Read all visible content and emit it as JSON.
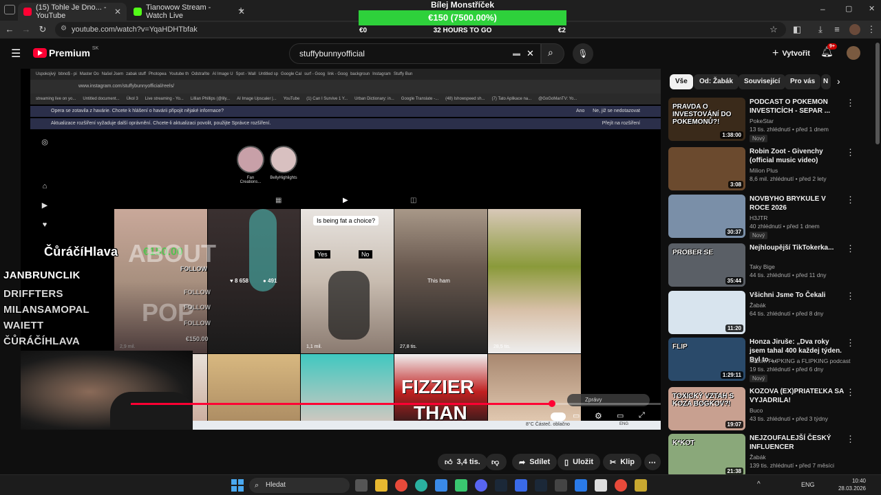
{
  "browser": {
    "tabs": [
      {
        "label": "(15) Tohle Je Dno... - YouTube",
        "active": true
      },
      {
        "label": "Tianowow Stream - Watch Live",
        "active": false
      }
    ],
    "url": "youtube.com/watch?v=YqaHDHTbfak"
  },
  "donation": {
    "name": "Bílej Monstříček",
    "amount": "€150 (7500.00%)",
    "progress_percent": 100,
    "left": "€0",
    "time": "32 HOURS TO GO",
    "right": "€2"
  },
  "youtube": {
    "logo": "Premium",
    "region": "SK",
    "search_value": "stuffybunnyofficial",
    "create_label": "Vytvořit",
    "notifications": "9+"
  },
  "video": {
    "inner_tabs": [
      "Uspokojivý",
      "bbno$ - pi",
      "Master Oo",
      "Našel Jsem",
      "zabak stuff",
      "Photopea",
      "Youtube th",
      "Odstraňte",
      "AI Image U",
      "Spot - Wall",
      "Untitled sp",
      "Google Cal",
      "surf - Goog",
      "link - Goog",
      "backgroun",
      "Instagram",
      "Stuffy Bun"
    ],
    "inner_url": "www.instagram.com/stuffybunnyofficial/reels/",
    "bookmarks": [
      "streaming live on yo...",
      "Untitled document...",
      "Úkol 3",
      "Live streaming - Yo...",
      "Lillian Phillips (@lily...",
      "AI Image Upscaler |...",
      "YouTube",
      "(1) Can I Survive 1 Y...",
      "Urban Dictionary: in...",
      "Google Translate -...",
      "(48) Ishowspeed sh...",
      "(7) Tato Aplikace na...",
      "@GoGoManTV: Yo..."
    ],
    "notice1": "Opera se zotavila z havárie. Chcete k hlášení o havárii připojit nějaké informace?",
    "notice1_yes": "Ano",
    "notice1_no": "Ne, již se nedotazovat",
    "notice2": "Aktualizace rozšíření vyžaduje další oprávnění. Chcete-li aktualizaci povolit, použijte Správce rozšíření.",
    "notice2_btn": "Přejít na rozšíření",
    "stories": [
      "Fan Creations...",
      "BellyHighlights"
    ],
    "reels": [
      {
        "stat": "2,9 mil.",
        "text": "ABOUT"
      },
      {
        "stat": "",
        "likes": "8 658",
        "comments": "491"
      },
      {
        "stat": "1,1 mil.",
        "caption": "Is being fat a choice?",
        "yes": "Yes",
        "no": "No"
      },
      {
        "stat": "27,8 tis.",
        "caption2": "This ham"
      },
      {
        "stat": "28,5 tis."
      }
    ],
    "row2_text": [
      "FIZZIER",
      "THAN"
    ],
    "pop_text": "POP",
    "chat_control": "Zprávy",
    "inner_weather": "8°C  Částeč. oblačno",
    "inner_lang": "ENG"
  },
  "overlay": {
    "top_name": "ČůráčíHlava",
    "top_amount": "€150.00",
    "follows": [
      "FOLLOW",
      "FOLLOW",
      "FOLLOW",
      "FOLLOW"
    ],
    "follow_amount": "€150.00",
    "list": [
      "JANBRUNCLIK",
      "DRIFFTERS",
      "MILANSAMOPAL",
      "WAIETT",
      "ČŮRÁČÍHLAVA"
    ]
  },
  "actions": {
    "likes": "3,4 tis.",
    "share": "Sdílet",
    "save": "Uložit",
    "clip": "Klip"
  },
  "chips": [
    "Vše",
    "Od: Žabák",
    "Související",
    "Pro vás",
    "N"
  ],
  "recommendations": [
    {
      "title": "PODCAST O POKEMON INVESTICÍCH - SEPAR ...",
      "channel": "PokeStar",
      "meta": "13 tis. zhlédnutí • před 1 dnem",
      "badge": "Nový",
      "duration": "1:38:00",
      "thumb_text": "PRAVDA O INVESTOVÁNÍ DO POKEMONŮ?!",
      "bg": "#3a2a1a"
    },
    {
      "title": "Robin Zoot - Givenchy (official music video)",
      "channel": "Milion Plus",
      "meta": "8,6 mil. zhlédnutí • před 2 lety",
      "badge": "",
      "duration": "3:08",
      "thumb_text": "",
      "bg": "#6b4a2e"
    },
    {
      "title": "NOVBYHO BRYKULE V ROCE 2026",
      "channel": "H3JTR",
      "meta": "40 zhlédnutí • před 1 dnem",
      "badge": "Nový",
      "duration": "30:37",
      "thumb_text": "",
      "bg": "#7a8fa8"
    },
    {
      "title": "Nejhloupější TikTokerka...",
      "channel": "Taky Bige",
      "meta": "44 tis. zhlédnutí • před 11 dny",
      "badge": "",
      "duration": "35:44",
      "thumb_text": "PROBER SE",
      "bg": "#5a5f66"
    },
    {
      "title": "Všichni Jsme To Čekali",
      "channel": "Žabák",
      "meta": "64 tis. zhlédnutí • před 8 dny",
      "badge": "",
      "duration": "11:20",
      "thumb_text": "",
      "bg": "#d8e4ee"
    },
    {
      "title": "Honza Jiruše: „Dva roky jsem tahal 400 každej týden. Byl to ...",
      "channel": "Maxim FLIPKING a FLIPKING podcast",
      "meta": "19 tis. zhlédnutí • před 6 dny",
      "badge": "Nový",
      "duration": "1:29:11",
      "thumb_text": "FLIP",
      "bg": "#2a4a6a"
    },
    {
      "title": "KOZOVA (EX)PRIATEĽKA SA VYJADRILA!",
      "channel": "Buco",
      "meta": "43 tis. zhlédnutí • před 3 týdny",
      "badge": "",
      "duration": "19:07",
      "thumb_text": "TOXICKÝ VZTAH S KOZA BOGKOV?!",
      "bg": "#c8a090"
    },
    {
      "title": "NEJZOUFALEJŠÍ ČESKÝ INFLUENCER",
      "channel": "Žabák",
      "meta": "139 tis. zhlédnutí • před 7 měsíci",
      "badge": "",
      "duration": "21:38",
      "thumb_text": "K*KOT",
      "bg": "#8aa87a"
    }
  ],
  "taskbar": {
    "search": "Hledat",
    "lang": "ENG",
    "time": "10:40",
    "date": "28.03.2026"
  },
  "colors": {
    "youtube_red": "#ff0033",
    "donation_green": "#2ed13b",
    "background": "#0f0f0f"
  }
}
